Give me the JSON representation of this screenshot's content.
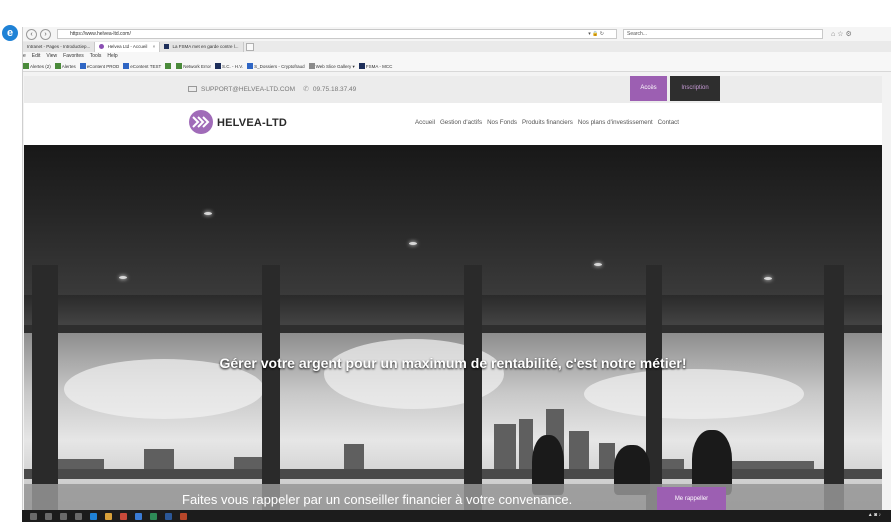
{
  "browser": {
    "url": "https://www.helvea-ltd.com/",
    "search_placeholder": "Search...",
    "tabs": [
      {
        "label": "Intranet - Pages - Introductiep..."
      },
      {
        "label": "Helvea Ltd - Accueil"
      },
      {
        "label": "La FSMA met en garde contre l..."
      }
    ],
    "menu": [
      "e",
      "Edit",
      "View",
      "Favorites",
      "Tools",
      "Help"
    ],
    "favorites": [
      {
        "label": "Alertes (2)",
        "icon": "green"
      },
      {
        "label": "Alertes",
        "icon": "green"
      },
      {
        "label": "eContent PROD",
        "icon": "blue"
      },
      {
        "label": "eContent TEST",
        "icon": "blue"
      },
      {
        "label": "",
        "icon": "green"
      },
      {
        "label": "Network Error",
        "icon": "green"
      },
      {
        "label": "S.C. - H.V.",
        "icon": "dark"
      },
      {
        "label": "S_Dossiers - Cryptofraud",
        "icon": "blue"
      },
      {
        "label": "Web Slice Gallery ▾",
        "icon": "gray"
      },
      {
        "label": "FSMA - MCC",
        "icon": "dark"
      }
    ]
  },
  "site": {
    "support_email": "SUPPORT@HELVEA-LTD.COM",
    "phone": "09.75.18.37.49",
    "acces_label": "Accès",
    "inscription_label": "Inscription",
    "logo_text": "HELVEA-LTD",
    "nav": [
      "Accueil",
      "Gestion d'actifs",
      "Nos Fonds",
      "Produits financiers",
      "Nos plans d'investissement",
      "Contact"
    ],
    "hero_title": "Gérer votre argent pour un maximum de rentabilité, c'est notre métier!",
    "callback_text": "Faites vous rappeler par un conseiller financier à votre convenance.",
    "callback_button": "Me rappeller"
  },
  "colors": {
    "brand_purple": "#9c5fb2",
    "dark_button": "#2e2e2e"
  }
}
